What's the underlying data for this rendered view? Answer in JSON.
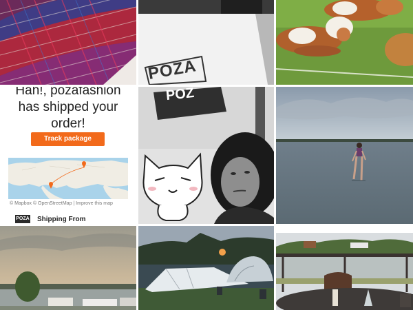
{
  "tiles": [
    {
      "label": "tweed-fabric-photo"
    },
    {
      "label": "poza-shopping-bag-photo"
    },
    {
      "label": "cows-resting-photo"
    },
    {
      "label": "shipping-notification"
    },
    {
      "label": "selfie-with-cat-sticker"
    },
    {
      "label": "woman-in-lake-photo"
    },
    {
      "label": "lakeside-sunset-camping-photo"
    },
    {
      "label": "campsite-tents-photo"
    },
    {
      "label": "terrace-table-photo"
    }
  ],
  "shipping": {
    "line1": "Hah!, pozafashion",
    "line2": "has shipped your",
    "line3": "order!",
    "button": "Track package",
    "map_credit": "© Mapbox © OpenStreetMap | Improve this map",
    "footer_logo": "POZA",
    "footer_text": "Shipping From"
  },
  "bag": {
    "logo": "POZA"
  },
  "selfie": {
    "logo": "POZ"
  },
  "colors": {
    "button": "#f26a1b",
    "map_water": "#a9d3ea",
    "map_land": "#f0ede4"
  }
}
